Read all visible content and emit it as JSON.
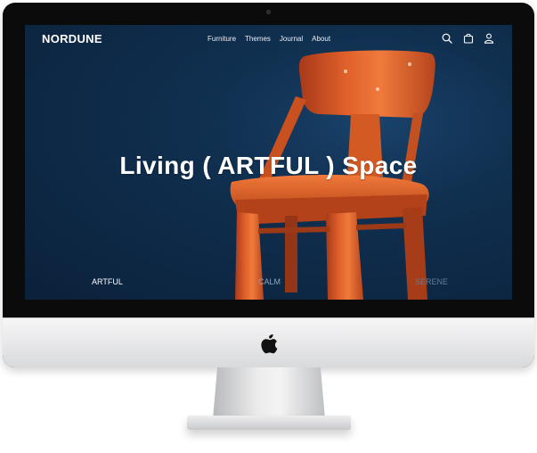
{
  "brand": "NORDUNE",
  "nav": {
    "items": [
      "Furniture",
      "Themes",
      "Journal",
      "About"
    ],
    "icons": [
      "search-icon",
      "bag-icon",
      "user-icon"
    ]
  },
  "hero": {
    "headline": "Living ( ARTFUL ) Space"
  },
  "tabs": [
    {
      "label": "ARTFUL",
      "active": true
    },
    {
      "label": "CALM",
      "active": false
    },
    {
      "label": "SERENE",
      "active": false
    }
  ],
  "colors": {
    "background": "#0f2d4c",
    "chair": "#d9541e",
    "text": "#ffffff",
    "inactive_tab": "#8ea6bf"
  }
}
